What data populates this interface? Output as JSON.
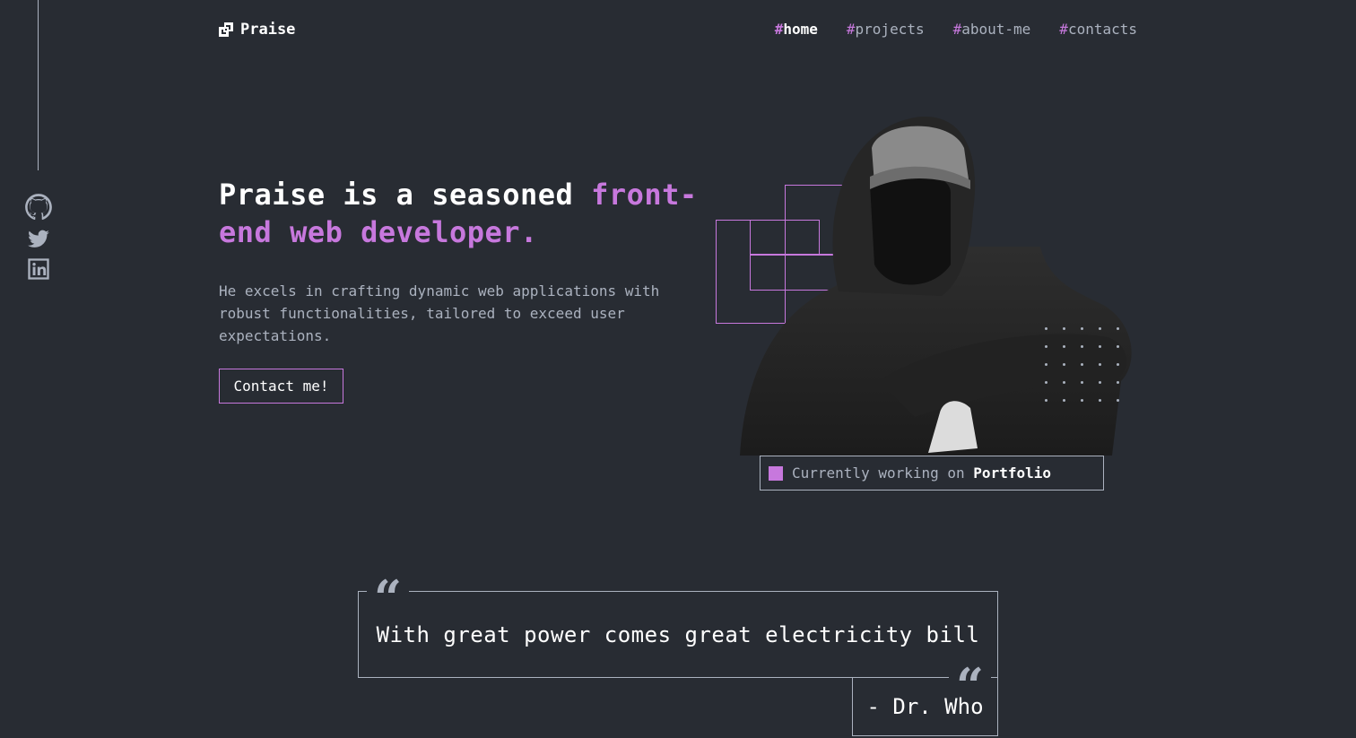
{
  "header": {
    "logo_text": "Praise",
    "nav": [
      {
        "hash": "#",
        "label": "home",
        "active": true
      },
      {
        "hash": "#",
        "label": "projects",
        "active": false
      },
      {
        "hash": "#",
        "label": "about-me",
        "active": false
      },
      {
        "hash": "#",
        "label": "contacts",
        "active": false
      }
    ]
  },
  "socials": [
    "github-icon",
    "twitter-icon",
    "linkedin-icon"
  ],
  "hero": {
    "title_plain": "Praise is a seasoned ",
    "title_accent": "front-end web developer.",
    "description": "He excels in crafting dynamic web applications with robust functionalities, tailored to exceed user expectations.",
    "button_label": "Contact me!"
  },
  "status": {
    "prefix": "Currently working on ",
    "project": "Portfolio"
  },
  "quote": {
    "open_mark": "“",
    "close_mark": "“",
    "text": "With great power comes great electricity bill",
    "author": "- Dr. Who"
  },
  "colors": {
    "background": "#282c33",
    "accent": "#c778dd",
    "text": "#abb2bf",
    "white": "#ffffff"
  }
}
